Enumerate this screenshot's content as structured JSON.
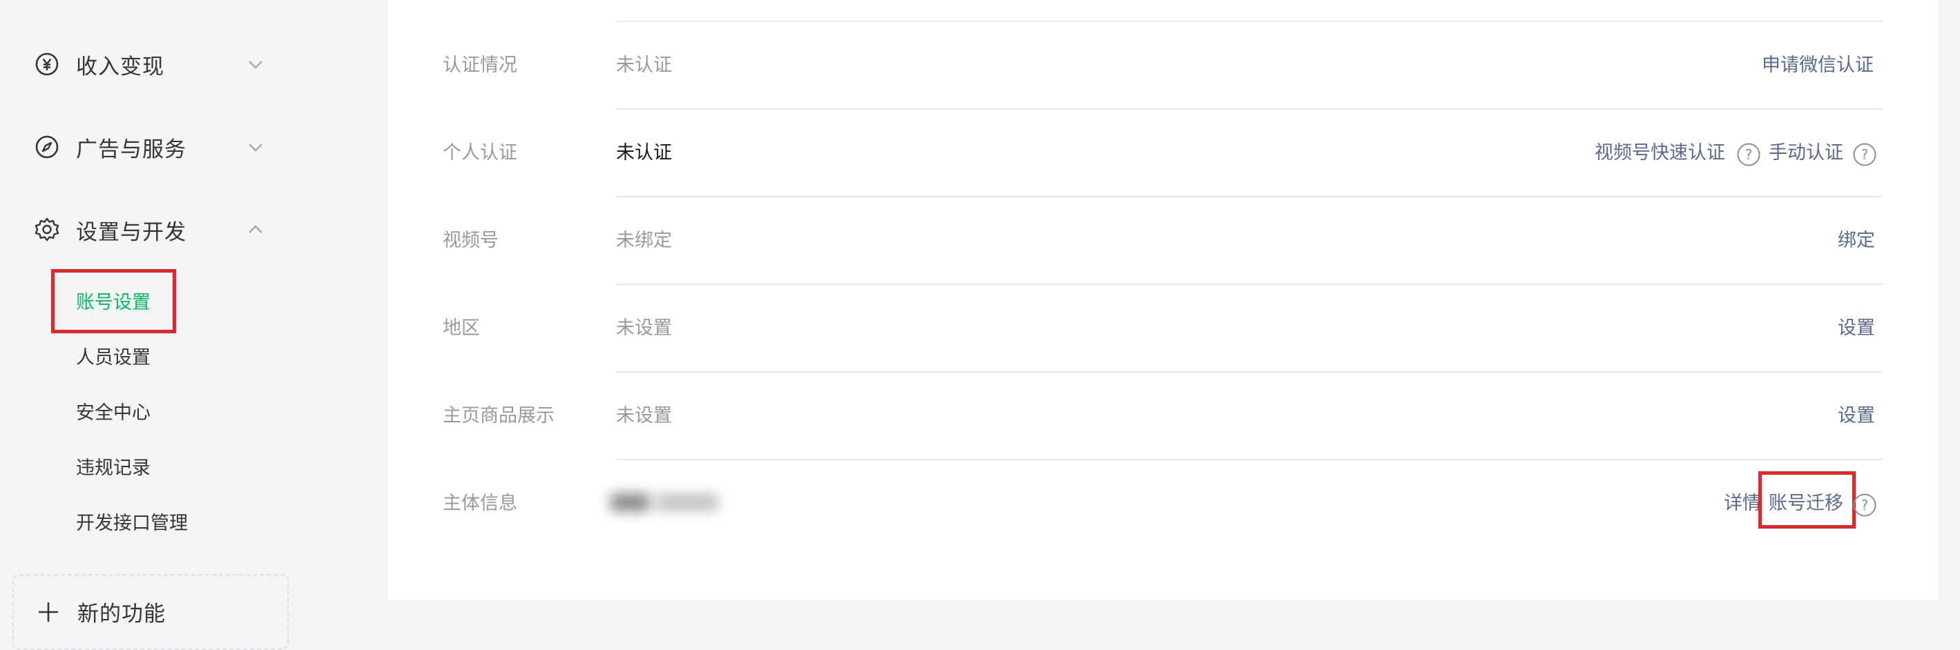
{
  "sidebar": {
    "groups": [
      {
        "label": "收入变现",
        "icon": "yuan-circle-icon",
        "expanded": false
      },
      {
        "label": "广告与服务",
        "icon": "compass-icon",
        "expanded": false
      },
      {
        "label": "设置与开发",
        "icon": "gear-icon",
        "expanded": true
      }
    ],
    "sub_items": [
      {
        "label": "账号设置",
        "active": true
      },
      {
        "label": "人员设置",
        "active": false
      },
      {
        "label": "安全中心",
        "active": false
      },
      {
        "label": "违规记录",
        "active": false
      },
      {
        "label": "开发接口管理",
        "active": false
      }
    ],
    "new_feature_label": "新的功能"
  },
  "settings": {
    "rows": [
      {
        "label": "认证情况",
        "value": "未认证",
        "actions": [
          "申请微信认证"
        ]
      },
      {
        "label": "个人认证",
        "value": "未认证",
        "actions": [
          "视频号快速认证",
          "手动认证"
        ]
      },
      {
        "label": "视频号",
        "value": "未绑定",
        "actions": [
          "绑定"
        ]
      },
      {
        "label": "地区",
        "value": "未设置",
        "actions": [
          "设置"
        ]
      },
      {
        "label": "主页商品展示",
        "value": "未设置",
        "actions": [
          "设置"
        ]
      },
      {
        "label": "主体信息",
        "value": "",
        "actions": [
          "详情",
          "账号迁移"
        ]
      }
    ]
  },
  "colors": {
    "accent_green": "#07c160",
    "link_blue": "#576b95",
    "highlight_red": "#e5252a"
  }
}
